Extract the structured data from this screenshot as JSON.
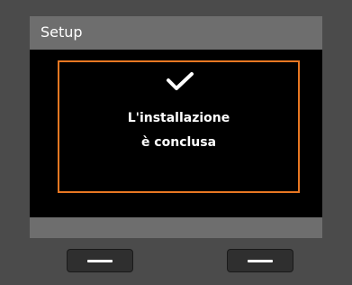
{
  "screen": {
    "title": "Setup",
    "message_line1": "L'installazione",
    "message_line2": "è conclusa",
    "icon": "checkmark-icon",
    "accent_color": "#e87722"
  },
  "softkeys": {
    "left_icon": "dash-icon",
    "right_icon": "dash-icon"
  }
}
